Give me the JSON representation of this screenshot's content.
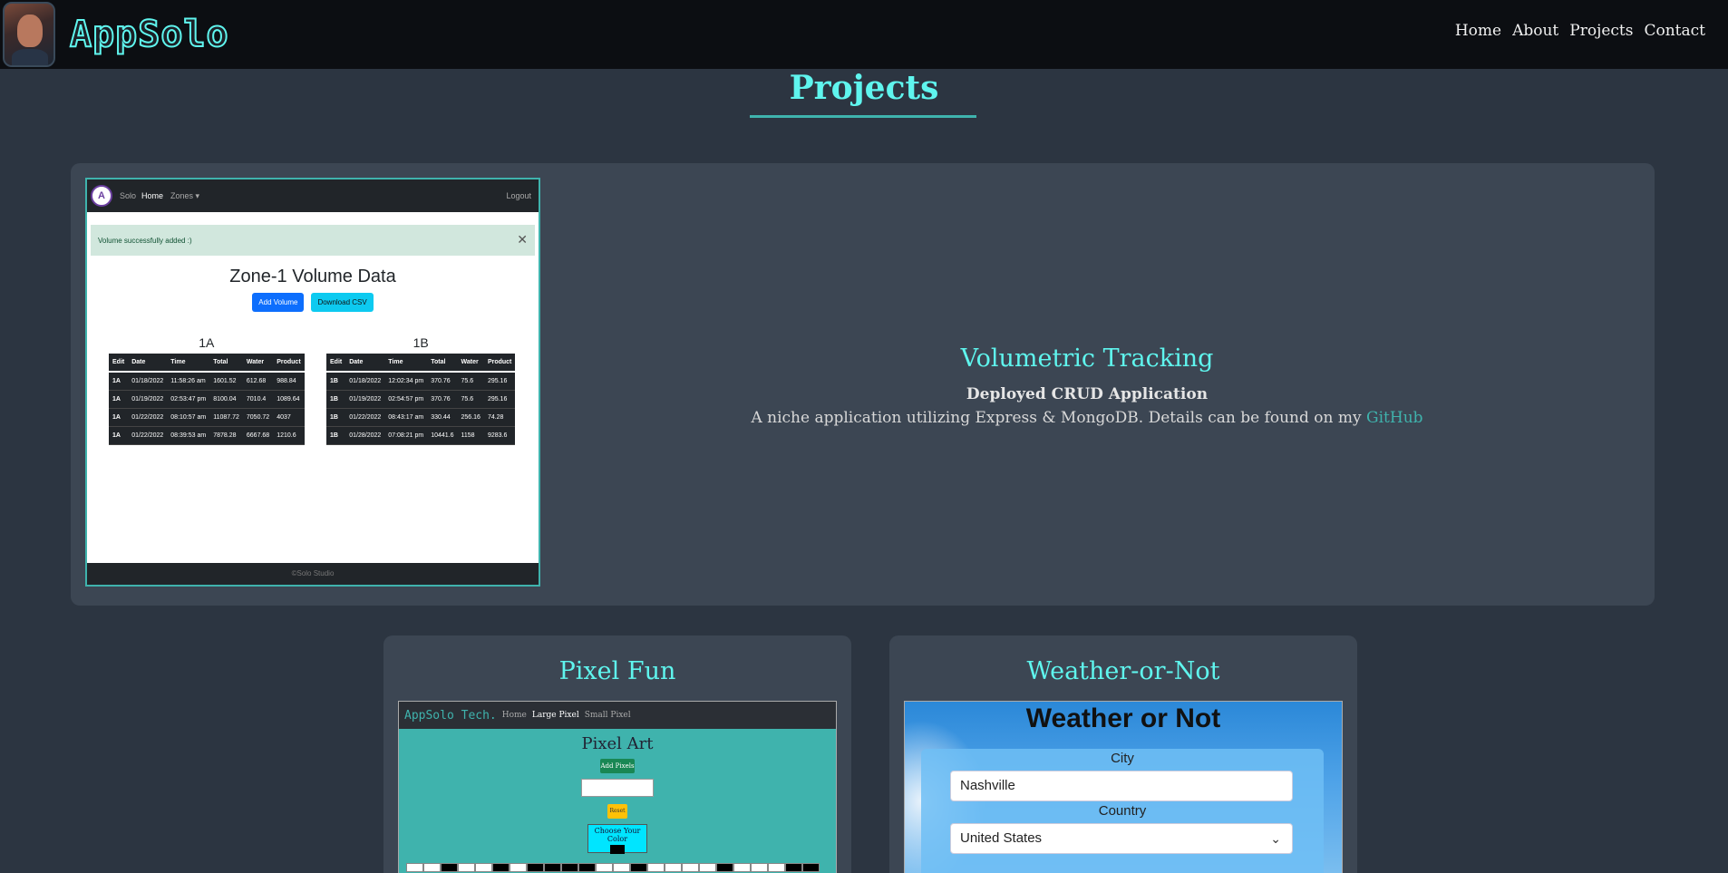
{
  "navbar": {
    "brand": "AppSolo",
    "links": [
      "Home",
      "About",
      "Projects",
      "Contact"
    ]
  },
  "section": {
    "title": "Projects"
  },
  "projects": {
    "main": {
      "title": "Volumetric Tracking",
      "subtitle": "Deployed CRUD Application",
      "description": "A niche application utilizing Express & MongoDB. Details can be found on my",
      "link_label": "GitHub",
      "screenshot": {
        "nav_brand": "Solo",
        "nav_home": "Home",
        "nav_zones": "Zones ▾",
        "nav_logout": "Logout",
        "alert": "Volume successfully added :)",
        "alert_close": "✕",
        "heading": "Zone-1 Volume Data",
        "btn_add": "Add Volume",
        "btn_csv": "Download CSV",
        "footer": "©Solo Studio",
        "columns": [
          "Edit",
          "Date",
          "Time",
          "Total",
          "Water",
          "Product"
        ],
        "table_1a": {
          "name": "1A",
          "rows": [
            [
              "1A",
              "01/18/2022",
              "11:58:26 am",
              "1601.52",
              "612.68",
              "988.84"
            ],
            [
              "1A",
              "01/19/2022",
              "02:53:47 pm",
              "8100.04",
              "7010.4",
              "1089.64"
            ],
            [
              "1A",
              "01/22/2022",
              "08:10:57 am",
              "11087.72",
              "7050.72",
              "4037"
            ],
            [
              "1A",
              "01/22/2022",
              "08:39:53 am",
              "7878.28",
              "6667.68",
              "1210.6"
            ]
          ]
        },
        "table_1b": {
          "name": "1B",
          "rows": [
            [
              "1B",
              "01/18/2022",
              "12:02:34 pm",
              "370.76",
              "75.6",
              "295.16"
            ],
            [
              "1B",
              "01/19/2022",
              "02:54:57 pm",
              "370.76",
              "75.6",
              "295.16"
            ],
            [
              "1B",
              "01/22/2022",
              "08:43:17 am",
              "330.44",
              "256.16",
              "74.28"
            ],
            [
              "1B",
              "01/28/2022",
              "07:08:21 pm",
              "10441.6",
              "1158",
              "9283.6"
            ]
          ]
        }
      }
    },
    "pixel": {
      "title": "Pixel Fun",
      "screenshot": {
        "brand": "AppSolo Tech.",
        "nav": [
          "Home",
          "Large Pixel",
          "Small Pixel"
        ],
        "heading": "Pixel Art",
        "btn_add": "Add Pixels",
        "btn_reset": "Reset",
        "color_label": "Choose Your Color"
      }
    },
    "weather": {
      "title": "Weather-or-Not",
      "screenshot": {
        "heading": "Weather or Not",
        "city_label": "City",
        "city_value": "Nashville",
        "country_label": "Country",
        "country_value": "United States"
      }
    }
  },
  "colors": {
    "accent": "#5ff5ee",
    "link": "#3fb3ad",
    "background": "#2c3541",
    "card": "#3c4653",
    "navbar": "#0c0e12"
  }
}
